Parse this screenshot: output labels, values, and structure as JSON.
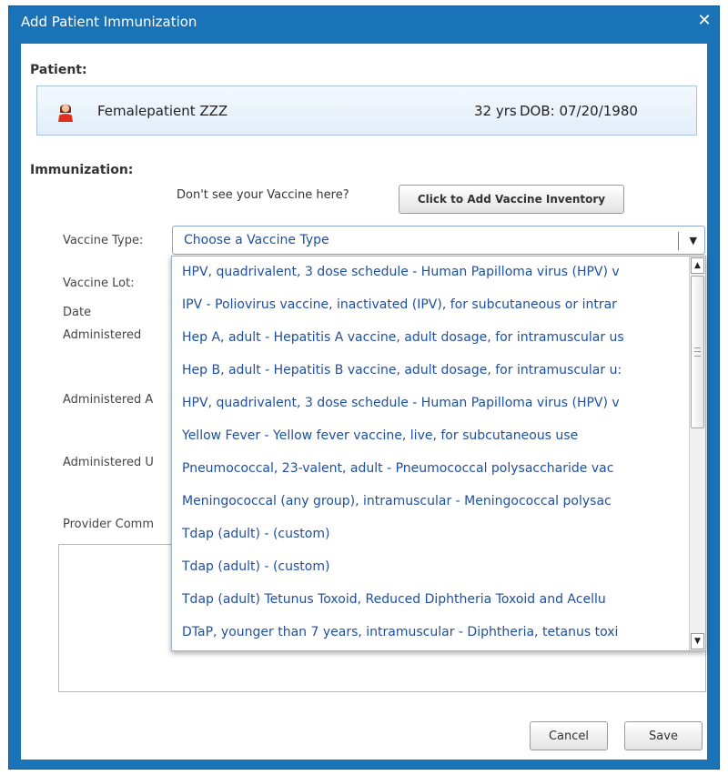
{
  "dialog": {
    "title": "Add Patient Immunization",
    "close_icon": "close-icon"
  },
  "patient": {
    "section_label": "Patient:",
    "avatar_icon": "female-avatar-icon",
    "name": "Femalepatient ZZZ",
    "age": "32 yrs",
    "dob": "DOB: 07/20/1980"
  },
  "immunization": {
    "section_label": "Immunization:",
    "hint": "Don't see your Vaccine here?",
    "add_inventory_label": "Click to Add Vaccine Inventory"
  },
  "fields": {
    "vaccine_type": "Vaccine Type:",
    "vaccine_lot": "Vaccine Lot:",
    "date_administered_line1": "Date",
    "date_administered_line2": "Administered",
    "administered_amount": "Administered A",
    "administered_units": "Administered U",
    "provider_comments": "Provider Comm"
  },
  "vaccine_select": {
    "value": "Choose a Vaccine Type",
    "arrow_icon": "chevron-down-icon"
  },
  "dropdown_options": [
    "HPV, quadrivalent, 3 dose schedule - Human Papilloma virus (HPV) v",
    "IPV - Poliovirus vaccine, inactivated (IPV), for subcutaneous or intrar",
    "Hep A, adult - Hepatitis A vaccine, adult dosage, for intramuscular us",
    "Hep B, adult - Hepatitis B vaccine, adult dosage, for intramuscular u:",
    "HPV, quadrivalent, 3 dose schedule - Human Papilloma virus (HPV) v",
    "Yellow Fever - Yellow fever vaccine, live, for subcutaneous use",
    "Pneumococcal, 23-valent, adult - Pneumococcal polysaccharide vac",
    "Meningococcal (any group), intramuscular - Meningococcal polysac",
    "Tdap (adult) - (custom)",
    "Tdap (adult) - (custom)",
    "Tdap (adult) Tetunus Toxoid, Reduced Diphtheria Toxoid and Acellu",
    "DTaP, younger than 7 years, intramuscular - Diphtheria, tetanus toxi"
  ],
  "buttons": {
    "cancel": "Cancel",
    "save": "Save"
  },
  "colors": {
    "title_bar": "#1a73b6",
    "link_text": "#1f4fa0"
  }
}
